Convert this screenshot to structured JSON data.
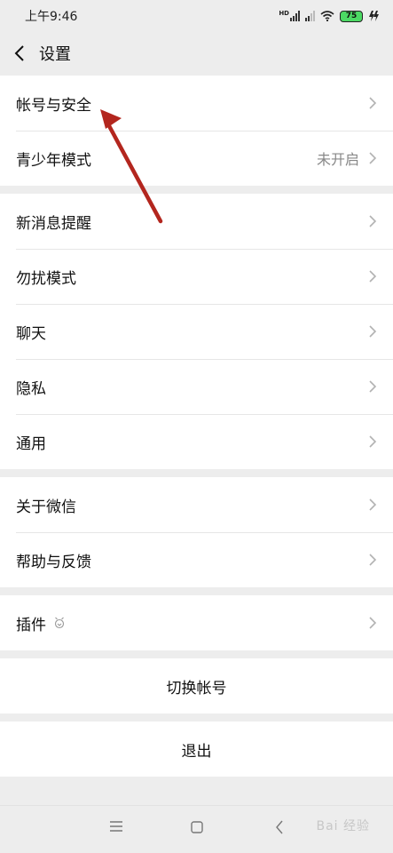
{
  "status_bar": {
    "time": "上午9:46",
    "network": "HD",
    "battery": "75"
  },
  "header": {
    "title": "设置"
  },
  "groups": [
    {
      "items": [
        {
          "label": "帐号与安全"
        },
        {
          "label": "青少年模式",
          "value": "未开启"
        }
      ]
    },
    {
      "items": [
        {
          "label": "新消息提醒"
        },
        {
          "label": "勿扰模式"
        },
        {
          "label": "聊天"
        },
        {
          "label": "隐私"
        },
        {
          "label": "通用"
        }
      ]
    },
    {
      "items": [
        {
          "label": "关于微信"
        },
        {
          "label": "帮助与反馈"
        }
      ]
    },
    {
      "items": [
        {
          "label": "插件"
        }
      ]
    }
  ],
  "actions": {
    "switch_account": "切换帐号",
    "logout": "退出"
  },
  "watermark": "Bai 经验",
  "colors": {
    "background": "#ededed",
    "annotation_arrow": "#b3261e",
    "battery": "#4cd964"
  }
}
